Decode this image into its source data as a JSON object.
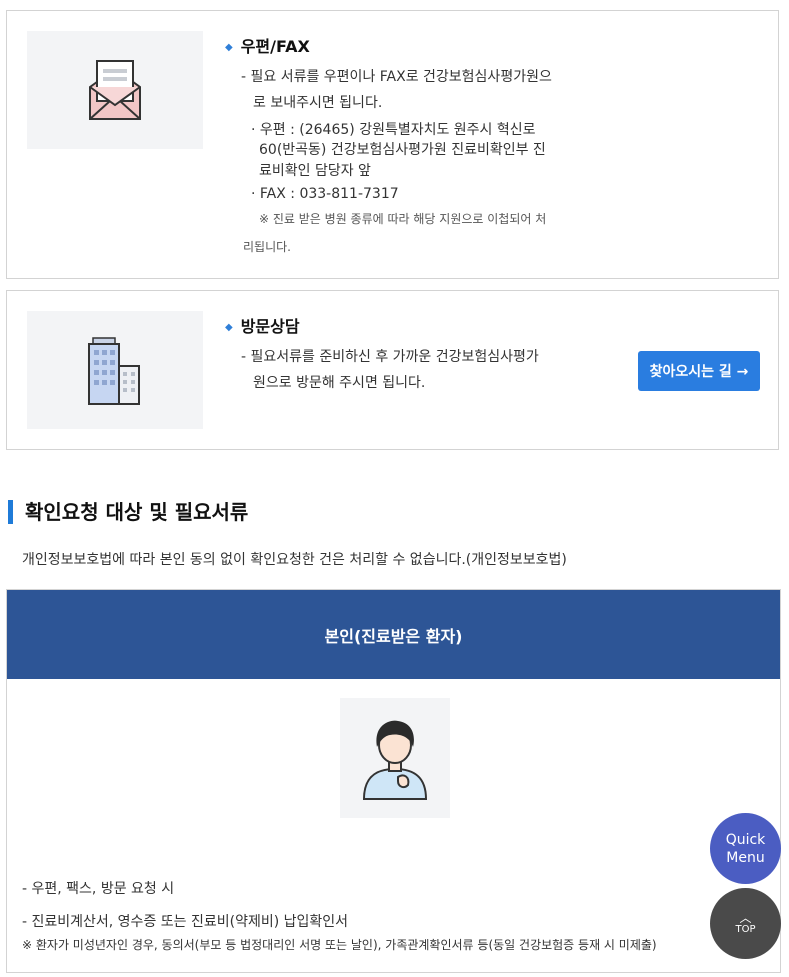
{
  "mail_card": {
    "title": "우편/FAX",
    "desc_line1": "- 필요 서류를 우편이나 FAX로 건강보험심사평가원으",
    "desc_line2": "로 보내주시면 됩니다.",
    "addr_line1": "· 우편 : (26465) 강원특별자치도 원주시 혁신로",
    "addr_line2": "60(반곡동) 건강보험심사평가원 진료비확인부 진",
    "addr_line3": "료비확인 담당자 앞",
    "fax": "· FAX : 033-811-7317",
    "note_line1": "※ 진료 받은 병원 종류에 따라 해당 지원으로 이첩되어 처",
    "note_line2": "리됩니다.",
    "icon": "envelope-icon"
  },
  "visit_card": {
    "title": "방문상담",
    "desc_line1": "- 필요서류를 준비하신 후 가까운 건강보험심사평가",
    "desc_line2": "원으로 방문해 주시면 됩니다.",
    "button_label": "찾아오시는 길 →",
    "icon": "building-icon",
    "button_color": "#2a7de0"
  },
  "section": {
    "title": "확인요청 대상 및 필요서류",
    "notice": "개인정보보호법에 따라 본인 동의 없이 확인요청한 건은 처리할 수 없습니다.(개인정보보호법)"
  },
  "table": {
    "header": "본인(진료받은 환자)",
    "header_color": "#2d5596",
    "item1": "- 우편, 팩스, 방문 요청 시",
    "item2": "- 진료비계산서, 영수증 또는 진료비(약제비) 납입확인서",
    "foot_note": "※ 환자가 미성년자인 경우, 동의서(부모 등 법정대리인 서명 또는 날인), 가족관계확인서류 등(동일 건강보험증 등재 시 미제출)",
    "icon": "patient-icon"
  },
  "floating": {
    "quick_line1": "Quick",
    "quick_line2": "Menu",
    "top_label": "TOP"
  }
}
